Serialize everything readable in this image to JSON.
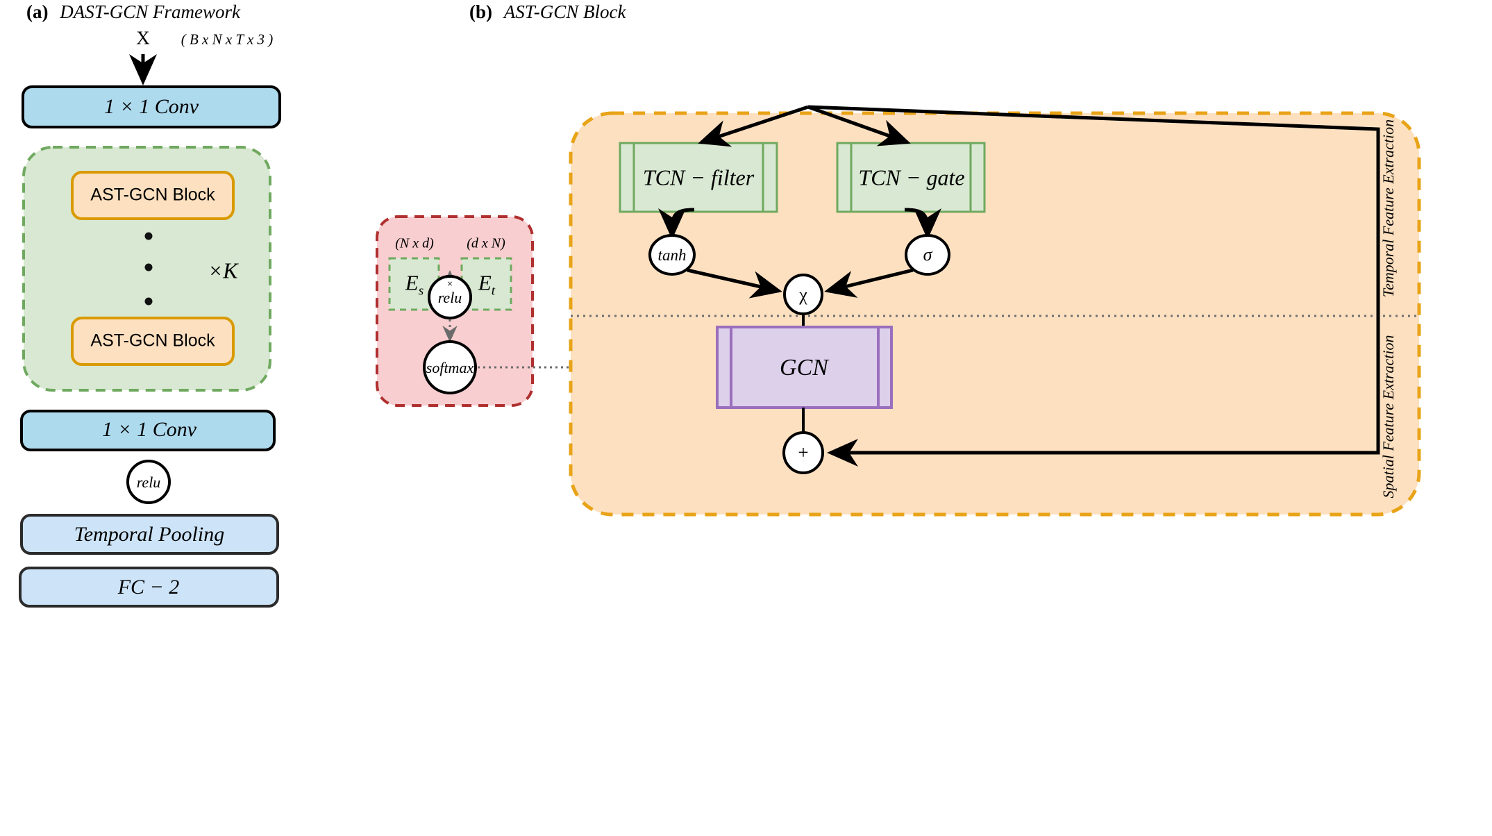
{
  "figure": {
    "panel_a": {
      "tag": "(a)",
      "title": "DAST-GCN Framework",
      "input_symbol": "X",
      "input_shape": "( B x N x T x 3 )",
      "blocks": [
        {
          "id": "conv-top",
          "label": "1 × 1   Conv",
          "style": "conv"
        },
        {
          "id": "ast-block-1",
          "label": "AST-GCN Block",
          "style": "ast"
        },
        {
          "id": "ast-block-2",
          "label": "AST-GCN Block",
          "style": "ast"
        },
        {
          "id": "conv-bottom",
          "label": "1 × 1   Conv",
          "style": "conv"
        },
        {
          "id": "relu",
          "label": "relu",
          "style": "circle"
        },
        {
          "id": "pooling",
          "label": "Temporal   Pooling",
          "style": "pool"
        },
        {
          "id": "fc",
          "label": "FC − 2",
          "style": "pool"
        }
      ],
      "repeat_label": "×K",
      "ellipsis_dots": 3
    },
    "panel_b": {
      "tag": "(b)",
      "title": "AST-GCN Block",
      "adjacency_group": {
        "shape_left": "(N x d)",
        "shape_right": "(d x N)",
        "embed_left": "E",
        "embed_left_sub": "s",
        "embed_right": "E",
        "embed_right_sub": "t",
        "mul_symbol": "×",
        "relu_label": "relu",
        "softmax_label": "softmax"
      },
      "tcn_filter_label": "TCN − filter",
      "tcn_gate_label": "TCN − gate",
      "tanh_label": "tanh",
      "sigma_label": "σ",
      "mul_node_label": "χ",
      "gcn_label": "GCN",
      "add_node_label": "+",
      "side_label_temporal": "Temporal Feature Extraction",
      "side_label_spatial": "Spatial Feature Extraction"
    }
  },
  "colors": {
    "conv_fill": "#aedaee",
    "conv_stroke": "#000000",
    "pool_fill": "#cde4f8",
    "pool_stroke": "#2b2b2b",
    "green_fill": "#d8e8d2",
    "green_stroke": "#6fa95f",
    "orange_fill": "#fde0c0",
    "orange_stroke": "#e8a317",
    "ast_fill": "#fde0c0",
    "ast_stroke": "#d99a00",
    "pink_fill": "#f8ced0",
    "pink_stroke": "#b03030",
    "purple_fill": "#ddd0ea",
    "purple_stroke": "#9a6fbd",
    "node_fill": "#ffffff",
    "node_stroke": "#000000",
    "dotted": "#707070"
  }
}
